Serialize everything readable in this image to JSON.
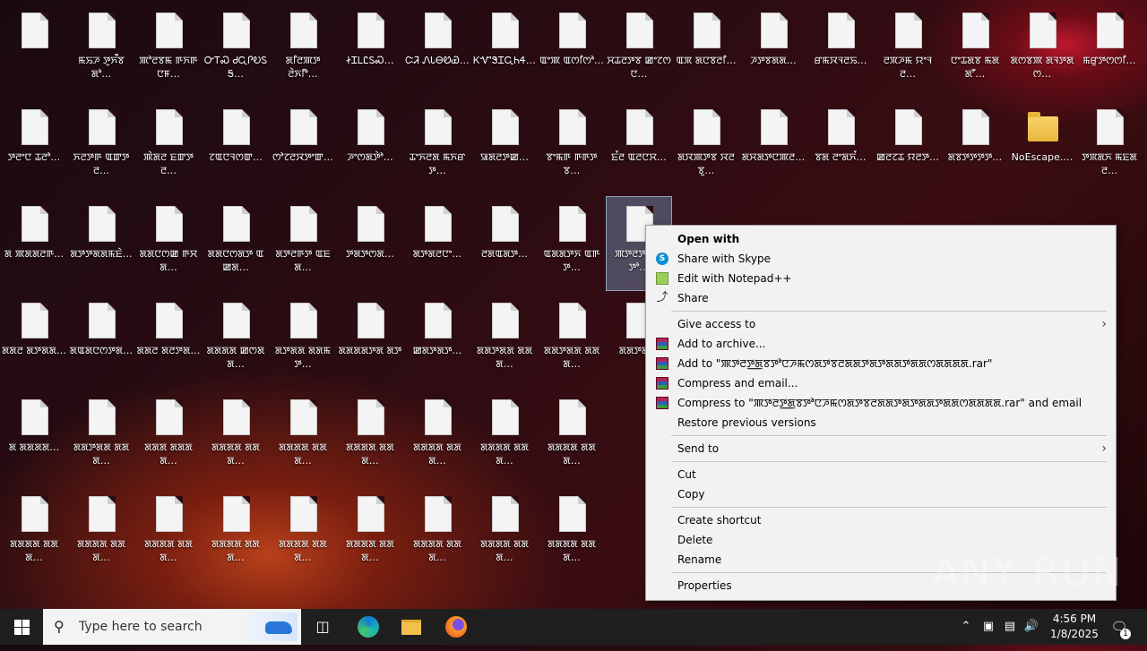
{
  "desktop": {
    "icons": [
      {
        "label": "",
        "kind": "file"
      },
      {
        "label": "ꯃꯢꯍ ꯇꯨꯈꯩꯕꯗꯣ…",
        "kind": "file"
      },
      {
        "label": "ꯄꯣꯂꯕꯃ ꯒꯈꯒꯅꯝ…",
        "kind": "file"
      },
      {
        "label": "ᏅᎢᏍ ᏧᏩᎵᎧᏚᎦ…",
        "kind": "file"
      },
      {
        "label": "ꯗꯤꯂꯄꯇ ꯂꯥꯈꯤꯣ…",
        "kind": "file"
      },
      {
        "label": "ᏐᏆᏞᏝᏚᏍ…",
        "kind": "file"
      },
      {
        "label": "ᏨᏘ ᏁᏓᎾᏬᏯ…",
        "kind": "file"
      },
      {
        "label": "ᏦᏉᏕᏆᏩᏂᏎ…",
        "kind": "file"
      },
      {
        "label": "ꯑꯦꯄ ꯑꯁꯤꯁꯣ…",
        "kind": "file"
      },
      {
        "label": "ꯆꯊꯂꯇꯕ ꯀꯦꯖꯁꯅ…",
        "kind": "file"
      },
      {
        "label": "ꯑꯞ ꯗꯅꯕꯂꯤ…",
        "kind": "file"
      },
      {
        "label": "ꯍꯇꯕꯗꯗ…",
        "kind": "file"
      },
      {
        "label": "ꯔꯃꯋꯜꯂꯢ…",
        "kind": "file"
      },
      {
        "label": "ꯂꯞꯍꯃ ꯌꯦꯜꯂ…",
        "kind": "file"
      },
      {
        "label": "ꯅꯦꯊꯗꯕ ꯃꯗꯗꯧ…",
        "kind": "file"
      },
      {
        "label": "ꯗꯁꯕꯄ ꯗꯜꯇꯗꯁ…",
        "kind": "file"
      },
      {
        "label": "ꯃꯔꯨꯇꯁꯁꯤ…",
        "kind": "file"
      },
      {
        "label": "ꯇꯂꯦꯅ ꯊꯂꯣ…",
        "kind": "file"
      },
      {
        "label": "ꯈꯂꯇꯒ ꯑꯛꯇꯂ…",
        "kind": "file"
      },
      {
        "label": "ꯄꯥꯗꯂ ꯐꯛꯇꯂ…",
        "kind": "file"
      },
      {
        "label": "ꯖꯑꯅꯜꯁꯛ…",
        "kind": "file"
      },
      {
        "label": "ꯁꯣꯖꯂꯋꯇꯦꯛ…",
        "kind": "file"
      },
      {
        "label": "ꯍꯦꯁꯗꯇꯥꯣ…",
        "kind": "file"
      },
      {
        "label": "ꯊꯦꯈꯂꯗ ꯃꯈꯔꯇ…",
        "kind": "file"
      },
      {
        "label": "ꯎꯗꯂꯇꯀ…",
        "kind": "file"
      },
      {
        "label": "ꯕꯦꯃꯒ ꯒꯒꯇꯕ…",
        "kind": "file"
      },
      {
        "label": "ꯐꯪꯂ ꯑꯂꯅꯆ…",
        "kind": "file"
      },
      {
        "label": "ꯗꯋꯄꯇꯕ ꯋꯂꯕꯨ…",
        "kind": "file"
      },
      {
        "label": "ꯗꯆꯗꯇꯅꯄꯂ…",
        "kind": "file"
      },
      {
        "label": "ꯕꯗ ꯂꯦꯗꯈꯪ…",
        "kind": "file"
      },
      {
        "label": "ꯀꯂꯖꯊ ꯌꯂꯇ…",
        "kind": "file"
      },
      {
        "label": "ꯗꯕꯇꯇꯇꯇ…",
        "kind": "file"
      },
      {
        "label": "NoEscape.…",
        "kind": "folder"
      },
      {
        "label": "ꯇꯞꯗꯈ ꯃꯐꯗꯂ…",
        "kind": "file"
      },
      {
        "label": "ꯗ ꯄꯗꯗꯂꯒ…",
        "kind": "file"
      },
      {
        "label": "ꯗꯇꯇꯗꯗꯃꯐꯥ…",
        "kind": "file"
      },
      {
        "label": "ꯗꯗꯅꯁꯀ ꯒꯆꯗ…",
        "kind": "file"
      },
      {
        "label": "ꯗꯗꯅꯁꯗꯇ ꯑꯀꯗ…",
        "kind": "file"
      },
      {
        "label": "ꯗꯇꯂꯒꯇ ꯑꯐꯗ…",
        "kind": "file"
      },
      {
        "label": "ꯇꯗꯇꯁꯗ…",
        "kind": "file"
      },
      {
        "label": "ꯗꯇꯗꯂꯅꯦ…",
        "kind": "file"
      },
      {
        "label": "ꯂꯗꯑꯗꯇ…",
        "kind": "file"
      },
      {
        "label": "ꯑꯗꯗꯇꯈ ꯑꯒꯇ…",
        "kind": "file"
      },
      {
        "label": "ꯄꯇꯂꯇ ꯗꯕꯇꯣ…",
        "kind": "file",
        "selected": true
      },
      {
        "label": "ꯗꯗꯂ ꯗꯇꯗꯗ…",
        "kind": "file"
      },
      {
        "label": "ꯗꯑꯗꯅꯁꯇꯗ…",
        "kind": "file"
      },
      {
        "label": "ꯗꯗꯂ ꯗꯂꯇꯗ…",
        "kind": "file"
      },
      {
        "label": "ꯗꯗꯗꯗ ꯀꯁꯗꯗ…",
        "kind": "file"
      },
      {
        "label": "ꯗꯇꯗꯗ ꯗꯗꯃꯇ…",
        "kind": "file"
      },
      {
        "label": "ꯗꯗꯗꯗꯇꯗ ꯗꯇ",
        "kind": "file"
      },
      {
        "label": "ꯀꯗꯇꯗꯇ…",
        "kind": "file"
      },
      {
        "label": "ꯗꯗꯇꯗꯗ ꯗꯗꯗ…",
        "kind": "file"
      },
      {
        "label": "ꯗꯗꯇꯗꯗ ꯗꯗꯗ…",
        "kind": "file"
      },
      {
        "label": "ꯗꯗꯇꯗ…",
        "kind": "file"
      },
      {
        "label": "ꯗ ꯗꯗꯗꯗ…",
        "kind": "file"
      },
      {
        "label": "ꯗꯗꯇꯗꯗ ꯗꯗꯗ…",
        "kind": "file"
      },
      {
        "label": "ꯗꯗꯗ ꯗꯗꯗꯗ…",
        "kind": "file"
      },
      {
        "label": "ꯗꯗꯗꯗ ꯗꯗꯗ…",
        "kind": "file"
      },
      {
        "label": "ꯗꯗꯗꯗ ꯗꯗꯗ…",
        "kind": "file"
      },
      {
        "label": "ꯗꯗꯗꯗ ꯗꯗꯗ…",
        "kind": "file"
      },
      {
        "label": "ꯗꯗꯗꯗ ꯗꯗꯗ…",
        "kind": "file"
      },
      {
        "label": "ꯗꯗꯗꯗ ꯗꯗꯗ…",
        "kind": "file"
      },
      {
        "label": "ꯗꯗꯗꯗ ꯗꯗꯗ…",
        "kind": "file"
      },
      {
        "label": "ꯗꯗꯗꯗ ꯗꯗꯗ…",
        "kind": "file"
      },
      {
        "label": "ꯗꯗꯗꯗ ꯗꯗꯗ…",
        "kind": "file"
      },
      {
        "label": "ꯗꯗꯗꯗ ꯗꯗꯗ…",
        "kind": "file"
      },
      {
        "label": "ꯗꯗꯗꯗ ꯗꯗꯗ…",
        "kind": "file"
      },
      {
        "label": "ꯗꯗꯗꯗ ꯗꯗꯗ…",
        "kind": "file"
      },
      {
        "label": "ꯗꯗꯗꯗ ꯗꯗꯗ…",
        "kind": "file"
      },
      {
        "label": "ꯗꯗꯗꯗ ꯗꯗꯗ…",
        "kind": "file"
      },
      {
        "label": "ꯗꯗꯗꯗ ꯗꯗꯗ…",
        "kind": "file"
      },
      {
        "label": "ꯗꯗꯗꯗ ꯗꯗꯗ…",
        "kind": "file"
      }
    ]
  },
  "context_menu": {
    "items": [
      {
        "label": "Open with",
        "bold": true
      },
      {
        "label": "Share with Skype",
        "icon": "skype-icon"
      },
      {
        "label": "Edit with Notepad++",
        "icon": "notepad-plus-plus-icon"
      },
      {
        "label": "Share",
        "icon": "share-icon"
      },
      {
        "separator": true
      },
      {
        "label": "Give access to",
        "submenu": true
      },
      {
        "label": "Add to archive...",
        "icon": "winrar-icon"
      },
      {
        "label": "Add to \"ꯄꯇꯂꯇ꯭ꯗꯕꯇꯣꯅꯍꯃꯁꯗꯇꯕꯂꯗꯗꯇꯗꯇꯗꯗꯇꯗꯗꯁꯗꯗꯗꯗ.rar\"",
        "icon": "winrar-icon"
      },
      {
        "label": "Compress and email...",
        "icon": "winrar-icon"
      },
      {
        "label": "Compress to \"ꯄꯇꯂꯇ꯭ꯗꯕꯇꯣꯅꯍꯃꯁꯗꯇꯕꯂꯗꯗꯇꯗꯇꯗꯗꯇꯗꯗꯁꯗꯗꯗꯗ.rar\" and email",
        "icon": "winrar-icon"
      },
      {
        "label": "Restore previous versions"
      },
      {
        "separator": true
      },
      {
        "label": "Send to",
        "submenu": true
      },
      {
        "separator": true
      },
      {
        "label": "Cut"
      },
      {
        "label": "Copy"
      },
      {
        "separator": true
      },
      {
        "label": "Create shortcut"
      },
      {
        "label": "Delete"
      },
      {
        "label": "Rename"
      },
      {
        "separator": true
      },
      {
        "label": "Properties"
      }
    ]
  },
  "watermark": "ANY RUN",
  "taskbar": {
    "search_placeholder": "Type here to search",
    "time": "4:56 PM",
    "date": "1/8/2025",
    "notification_count": "1"
  },
  "colors": {
    "taskbar": "#1f1f1f",
    "menu_bg": "#f2f2f2",
    "selection": "#7896be"
  }
}
